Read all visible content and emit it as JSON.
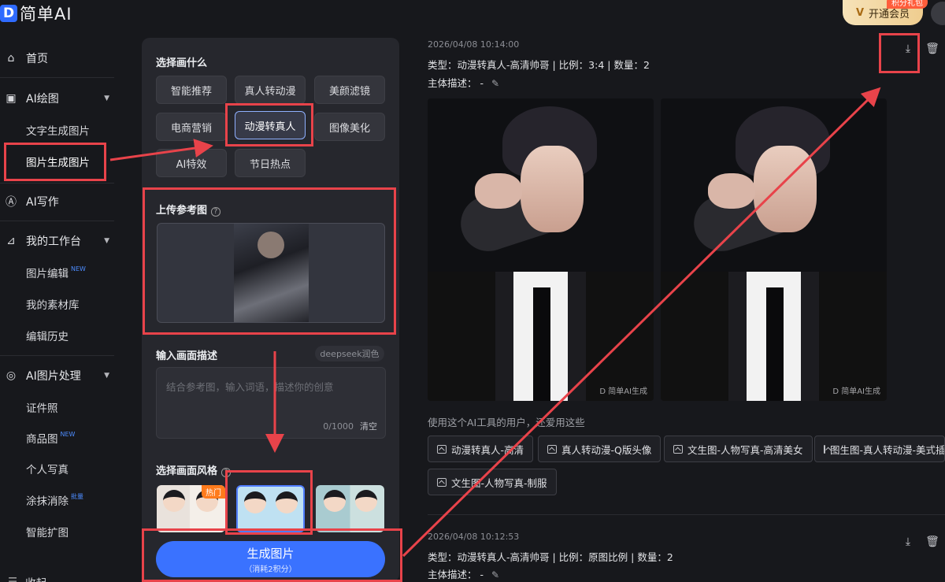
{
  "app": {
    "logo_mark": "D",
    "title": "简单AI"
  },
  "header": {
    "vip_label": "开通会员",
    "vip_badge": "积分礼包",
    "vip_icon": "v-crown-icon"
  },
  "sidebar": {
    "home": "首页",
    "ai_draw": "AI绘图",
    "text_to_image": "文字生成图片",
    "image_to_image": "图片生成图片",
    "ai_write": "AI写作",
    "workspace": "我的工作台",
    "image_edit": "图片编辑",
    "new_badge": "NEW",
    "materials": "我的素材库",
    "history": "编辑历史",
    "ai_image_process": "AI图片处理",
    "id_photo": "证件照",
    "product_image": "商品图",
    "portrait": "个人写真",
    "erase": "涂抹消除",
    "batch_badge": "批量",
    "expand": "智能扩图",
    "collapse": "收起"
  },
  "panel": {
    "choose_title": "选择画什么",
    "chips": [
      "智能推荐",
      "真人转动漫",
      "美颜滤镜",
      "电商营销",
      "动漫转真人",
      "图像美化",
      "AI特效",
      "节日热点"
    ],
    "selected_chip": "动漫转真人",
    "upload_title": "上传参考图",
    "upload_help": "?",
    "prompt_title": "输入画面描述",
    "deepseek_label": "deepseek润色",
    "prompt_placeholder": "结合参考图，输入词语，描述你的创意",
    "prompt_value": "",
    "counter": "0/1000",
    "clear_label": "清空",
    "style_title": "选择画面风格",
    "style_help": "?",
    "style_hot": "热门",
    "generate_label": "生成图片",
    "generate_cost": "（消耗2积分）"
  },
  "results": [
    {
      "timestamp": "2026/04/08 10:14:00",
      "meta": "类型：动漫转真人-高清帅哥 | 比例：3:4 | 数量：2",
      "subject_label": "主体描述：",
      "subject_value": "-",
      "watermark": "D 简单AI生成"
    },
    {
      "timestamp": "2026/04/08 10:12:53",
      "meta": "类型：动漫转真人-高清帅哥 | 比例：原图比例 | 数量：2",
      "subject_label": "主体描述：",
      "subject_value": "-"
    }
  ],
  "also_used": {
    "title": "使用这个AI工具的用户，还爱用这些",
    "tags": [
      "动漫转真人-高清",
      "真人转动漫-Q版头像",
      "文生图-人物写真-高清美女",
      "图生图-真人转动漫-美式插",
      "文生图-人物写真-制服"
    ]
  },
  "colors": {
    "accent": "#3a72ff",
    "annotation": "#e8434a",
    "background": "#17181c",
    "panel": "#26272d"
  }
}
